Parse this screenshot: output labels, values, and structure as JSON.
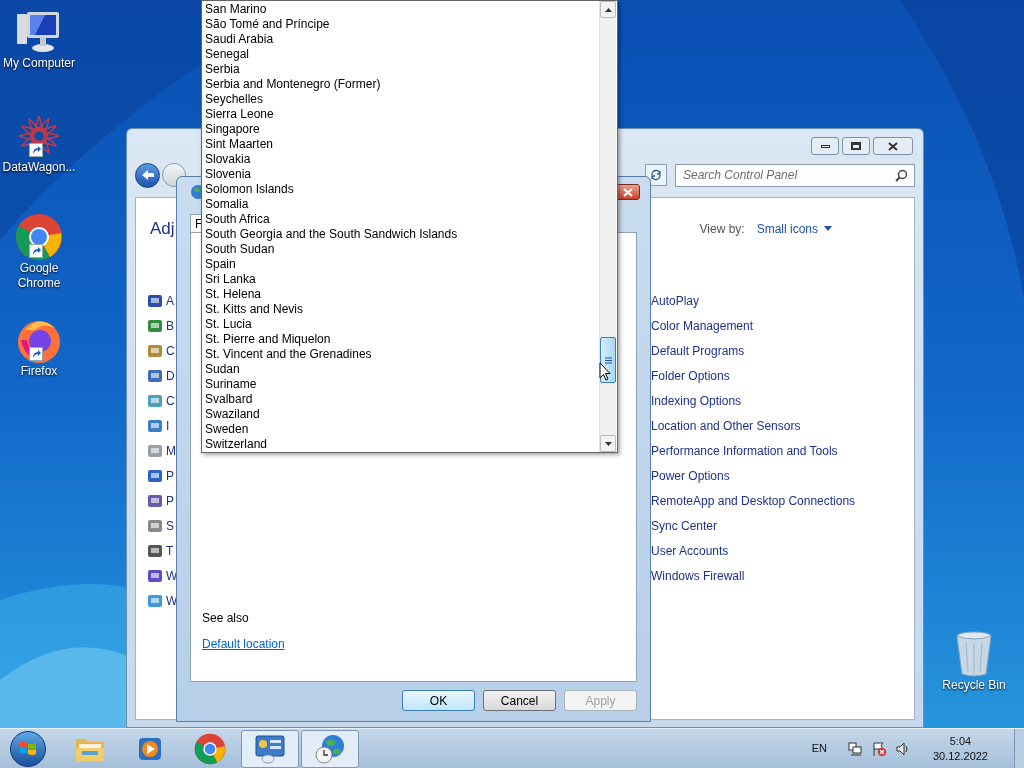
{
  "desktop_icons": [
    {
      "label": "My Computer",
      "kind": "computer",
      "shortcut": false
    },
    {
      "label": "DataWagon...",
      "kind": "network",
      "shortcut": true
    },
    {
      "label": "Google Chrome",
      "kind": "chrome",
      "shortcut": true
    },
    {
      "label": "Firefox",
      "kind": "firefox",
      "shortcut": true
    },
    {
      "label": "Recycle Bin",
      "kind": "bin",
      "shortcut": false
    }
  ],
  "control_panel": {
    "search": {
      "placeholder": "Search Control Panel"
    },
    "heading": "Adj",
    "view_by": {
      "label": "View by:",
      "value": "Small icons"
    },
    "left_items": [
      "A",
      "B",
      "C",
      "D",
      "C",
      "I",
      "M",
      "P",
      "P",
      "S",
      "T",
      "W",
      "W"
    ],
    "right_items": [
      "AutoPlay",
      "Color Management",
      "Default Programs",
      "Folder Options",
      "Indexing Options",
      "Location and Other Sensors",
      "Performance Information and Tools",
      "Power Options",
      "RemoteApp and Desktop Connections",
      "Sync Center",
      "User Accounts",
      "Windows Firewall"
    ]
  },
  "dialog": {
    "tab": "F",
    "see_also": "See also",
    "link": "Default location",
    "buttons": [
      {
        "label": "OK",
        "kind": "default",
        "disabled": false
      },
      {
        "label": "Cancel",
        "kind": "normal",
        "disabled": false
      },
      {
        "label": "Apply",
        "kind": "normal",
        "disabled": true
      }
    ]
  },
  "dropdown": {
    "items": [
      "San Marino",
      "São Tomé and Príncipe",
      "Saudi Arabia",
      "Senegal",
      "Serbia",
      "Serbia and Montenegro (Former)",
      "Seychelles",
      "Sierra Leone",
      "Singapore",
      "Sint Maarten",
      "Slovakia",
      "Slovenia",
      "Solomon Islands",
      "Somalia",
      "South Africa",
      "South Georgia and the South Sandwich Islands",
      "South Sudan",
      "Spain",
      "Sri Lanka",
      "St. Helena",
      "St. Kitts and Nevis",
      "St. Lucia",
      "St. Pierre and Miquelon",
      "St. Vincent and the Grenadines",
      "Sudan",
      "Suriname",
      "Svalbard",
      "Swaziland",
      "Sweden",
      "Switzerland"
    ]
  },
  "taskbar": {
    "apps": [
      {
        "kind": "explorer",
        "active": false
      },
      {
        "kind": "media",
        "active": false
      },
      {
        "kind": "chrome",
        "active": false
      },
      {
        "kind": "control-panel",
        "active": true
      },
      {
        "kind": "globe-clock",
        "active": true
      }
    ],
    "language": "EN",
    "time": "5:04",
    "date": "30.12.2022"
  }
}
